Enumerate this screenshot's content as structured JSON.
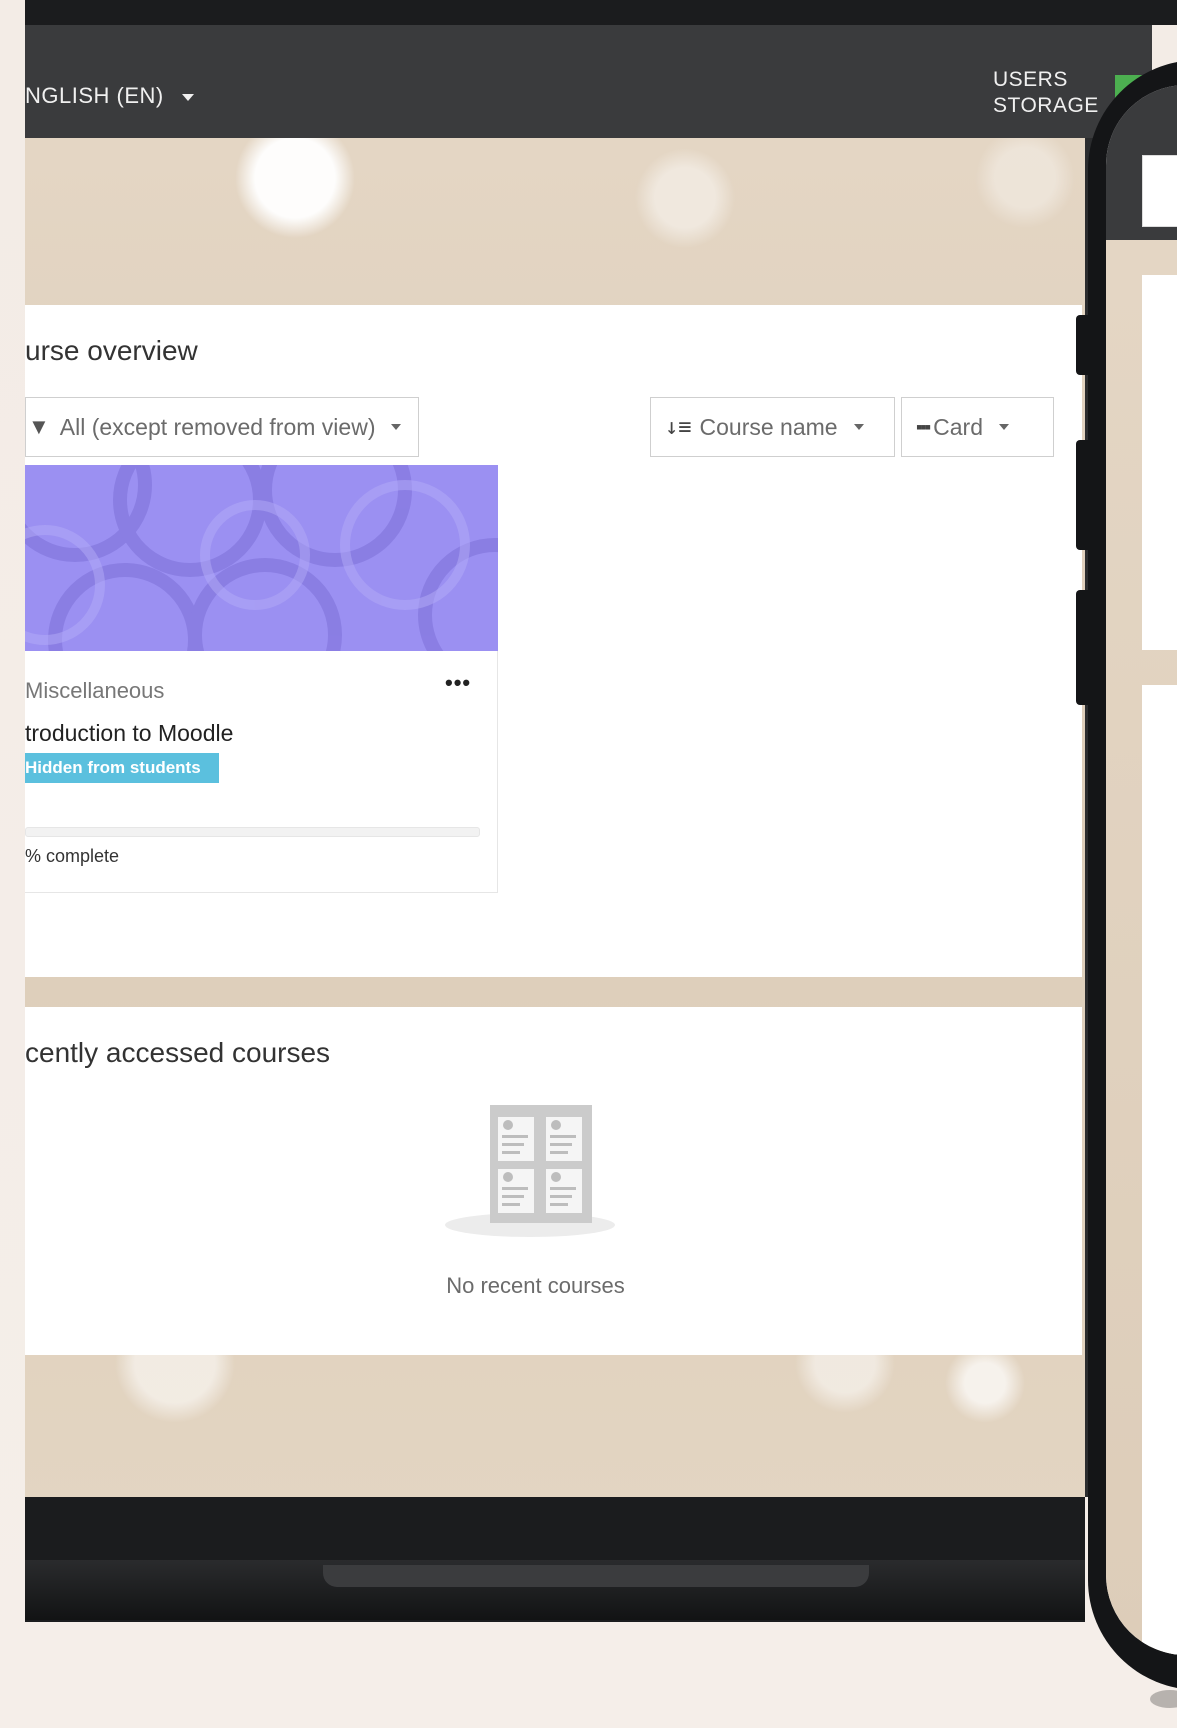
{
  "navbar": {
    "language_label": "NGLISH (EN)",
    "users_label": "USERS",
    "storage_label": "STORAGE"
  },
  "course_overview": {
    "title": "urse overview",
    "filter_dropdown": "All (except removed from view)",
    "sort_dropdown": "Course name",
    "view_dropdown": "Card",
    "course_card": {
      "category": "Miscellaneous",
      "name": "troduction to Moodle",
      "badge": "Hidden from students",
      "progress_percent": 0,
      "progress_text": "% complete"
    }
  },
  "recent_courses": {
    "title": "cently accessed courses",
    "empty_text": "No recent courses"
  },
  "colors": {
    "navbar": "#3a3b3d",
    "badge": "#5bc0de",
    "card_image": "#9b8ff0",
    "backdrop": "#e0d2bf"
  },
  "icons": {
    "filter": "filter-icon",
    "sort": "sort-icon",
    "view": "grid-icon",
    "more": "more-dots-icon",
    "caret": "caret-down-icon"
  }
}
